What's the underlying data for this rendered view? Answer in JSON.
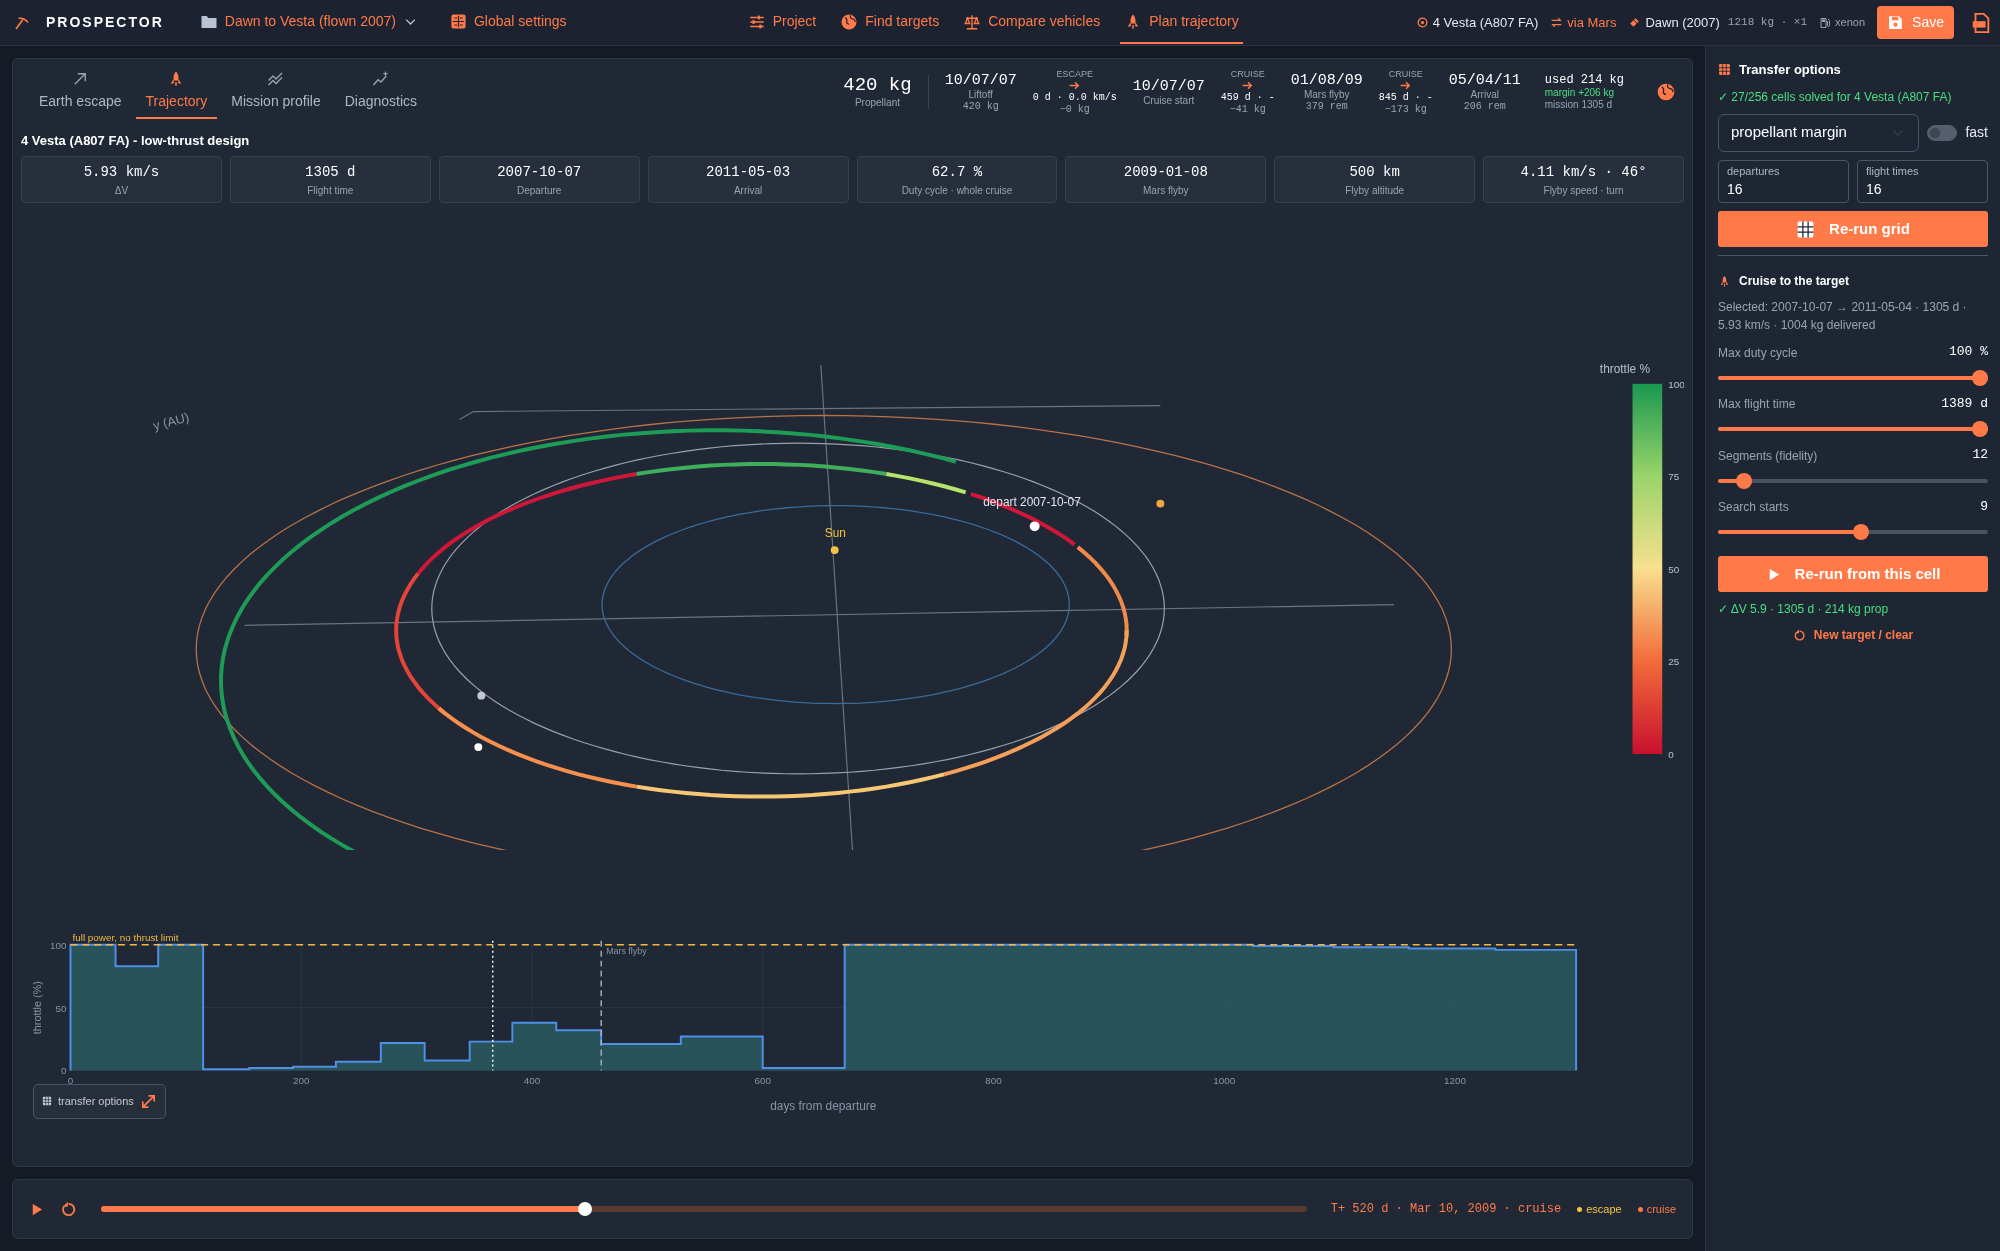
{
  "topbar": {
    "brand": "PROSPECTOR",
    "project": "Dawn to Vesta (flown 2007)",
    "global_settings": "Global settings",
    "nav": [
      {
        "label": "Project",
        "selected": false
      },
      {
        "label": "Find targets",
        "selected": false
      },
      {
        "label": "Compare vehicles",
        "selected": false
      },
      {
        "label": "Plan trajectory",
        "selected": true
      }
    ],
    "target": "4 Vesta (A807 FA)",
    "route": "via Mars",
    "vehicle": "Dawn (2007)",
    "mass": "1218 kg · ×1",
    "propellant": "xenon",
    "save": "Save"
  },
  "tabs": [
    {
      "label": "Earth escape",
      "selected": false
    },
    {
      "label": "Trajectory",
      "selected": true
    },
    {
      "label": "Mission profile",
      "selected": false
    },
    {
      "label": "Diagnostics",
      "selected": false
    }
  ],
  "timeline": {
    "propellant": "420 kg",
    "propellant_label": "Propellant",
    "items": [
      {
        "kind": "event",
        "date": "10/07/07",
        "label": "Liftoff",
        "sub": "420 kg"
      },
      {
        "kind": "leg",
        "tag": "ESCAPE",
        "line1": "0 d · 0.0 km/s",
        "line2": "−0 kg"
      },
      {
        "kind": "event",
        "date": "10/07/07",
        "label": "Cruise start"
      },
      {
        "kind": "leg",
        "tag": "CRUISE",
        "line1": "459 d · -",
        "line2": "−41 kg"
      },
      {
        "kind": "event",
        "date": "01/08/09",
        "label": "Mars flyby",
        "sub": "379 rem"
      },
      {
        "kind": "leg",
        "tag": "CRUISE",
        "line1": "845 d · -",
        "line2": "−173 kg"
      },
      {
        "kind": "event",
        "date": "05/04/11",
        "label": "Arrival",
        "sub": "206 rem"
      }
    ],
    "used": "used 214 kg",
    "margin": "margin +206 kg",
    "mission": "mission 1305 d"
  },
  "design_title": "4 Vesta (A807 FA) - low-thrust design",
  "stats": [
    {
      "value": "5.93 km/s",
      "label": "ΔV"
    },
    {
      "value": "1305 d",
      "label": "Flight time"
    },
    {
      "value": "2007-10-07",
      "label": "Departure"
    },
    {
      "value": "2011-05-03",
      "label": "Arrival"
    },
    {
      "value": "62.7 %",
      "label": "Duty cycle · whole cruise"
    },
    {
      "value": "2009-01-08",
      "label": "Mars flyby"
    },
    {
      "value": "500 km",
      "label": "Flyby altitude"
    },
    {
      "value": "4.11 km/s · 46°",
      "label": "Flyby speed · turn"
    }
  ],
  "orbit_view": {
    "axis_label": "y (AU)",
    "sun_label": "Sun",
    "depart_label": "depart 2007-10-07",
    "colorbar": {
      "title": "throttle %",
      "ticks": [
        "100",
        "75",
        "50",
        "25",
        "0"
      ]
    }
  },
  "throttle_chart": {
    "chart_data": {
      "type": "area",
      "xlabel": "days from departure",
      "ylabel": "throttle (%)",
      "x": [
        0,
        39,
        76,
        115,
        155,
        193,
        230,
        269,
        307,
        346,
        383,
        421,
        460,
        529,
        600,
        671,
        1025,
        1095,
        1160,
        1235,
        1305
      ],
      "values": [
        100,
        83,
        100,
        1,
        2,
        3,
        7,
        22,
        8,
        23,
        38,
        32,
        21,
        27,
        2,
        100,
        99,
        98,
        97,
        96,
        96
      ],
      "xlim": [
        0,
        1305
      ],
      "ylim": [
        0,
        100
      ],
      "xticks": [
        0,
        200,
        400,
        600,
        800,
        1000,
        1200
      ],
      "yticks": [
        0,
        50,
        100
      ],
      "grid": true,
      "ref_lines": [
        {
          "axis": "y",
          "value": 100,
          "label": "full power, no thrust limit"
        },
        {
          "axis": "x",
          "value": 366
        },
        {
          "axis": "x",
          "value": 460,
          "label": "Mars flyby"
        }
      ]
    }
  },
  "float_button": "transfer options",
  "playback": {
    "level": 0.4,
    "status": "T+ 520 d · Mar 10, 2009 · cruise",
    "legend": [
      {
        "label": "escape",
        "color": "#f5c542"
      },
      {
        "label": "cruise",
        "color": "#ff7a48"
      }
    ]
  },
  "panel": {
    "title": "Transfer options",
    "solved": "✓ 27/256 cells solved for 4 Vesta (A807 FA)",
    "metric": "propellant margin",
    "fast": {
      "label": "fast",
      "on": false
    },
    "fields": [
      {
        "label": "departures",
        "value": "16"
      },
      {
        "label": "flight times",
        "value": "16"
      }
    ],
    "rerun_grid": "Re-run grid",
    "section": "Cruise to the target",
    "selected": "Selected: 2007-10-07 → 2011-05-04 · 1305 d · 5.93 km/s · 1004 kg delivered",
    "sliders": [
      {
        "label": "Max duty cycle",
        "reading": "100 %",
        "level": 1.0
      },
      {
        "label": "Max flight time",
        "reading": "1389 d",
        "level": 1.0
      },
      {
        "label": "Segments (fidelity)",
        "reading": "12",
        "level": 0.07
      },
      {
        "label": "Search starts",
        "reading": "9",
        "level": 0.53
      }
    ],
    "rerun_cell": "Re-run from this cell",
    "result": "✓ ΔV 5.9 · 1305 d · 214 kg prop",
    "clear": "New target / clear"
  }
}
